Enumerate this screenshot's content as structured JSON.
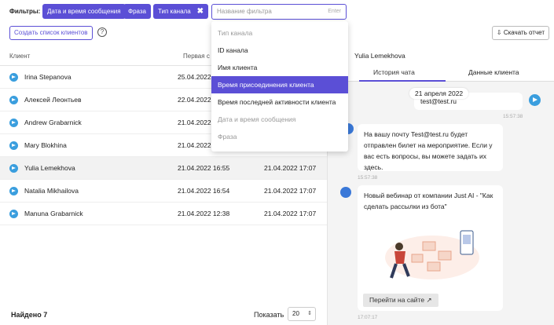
{
  "filters": {
    "label": "Фильтры:",
    "chips": [
      "Дата и время сообщения",
      "Фраза",
      "Тип канала"
    ],
    "chip_close": "✖",
    "input_placeholder": "Название фильтра",
    "input_hint": "Enter"
  },
  "toolbar": {
    "create_list": "Создать список клиентов",
    "help": "?",
    "report": "Скачать отчет"
  },
  "table": {
    "headers": [
      "Клиент",
      "Первая с"
    ],
    "rows": [
      {
        "name": "Irina Stepanova",
        "d1": "25.04.2022",
        "d2": ""
      },
      {
        "name": "Алексей Леонтьев",
        "d1": "22.04.2022",
        "d2": ""
      },
      {
        "name": "Andrew Grabarnick",
        "d1": "21.04.2022",
        "d2": ""
      },
      {
        "name": "Mary Blokhina",
        "d1": "21.04.2022",
        "d2": ""
      },
      {
        "name": "Yulia Lemekhova",
        "d1": "21.04.2022 16:55",
        "d2": "21.04.2022 17:07"
      },
      {
        "name": "Natalia Mikhailova",
        "d1": "21.04.2022 16:54",
        "d2": "21.04.2022 17:07"
      },
      {
        "name": "Manuna Grabarnick",
        "d1": "21.04.2022 12:38",
        "d2": "21.04.2022 17:07"
      }
    ]
  },
  "footer": {
    "found": "Найдено 7",
    "show": "Показать",
    "page_size": "20"
  },
  "panel": {
    "user": "Yulia Lemekhova",
    "tabs": [
      "История чата",
      "Данные клиента"
    ],
    "date": "21 апреля 2022",
    "msg_user": "test@test.ru",
    "time1": "15:57:38",
    "msg_bot1": "На вашу почту Test@test.ru будет отправлен билет на мероприятие. Если у вас есть вопросы, вы можете задать их здесь.",
    "time2": "15:57:38",
    "msg_bot2": "Новый вебинар от компании Just AI - \"Как сделать рассылки из бота\"",
    "site_button": "Перейти на сайте",
    "time3": "17:07:17"
  },
  "dropdown": {
    "items": [
      "Тип канала",
      "ID канала",
      "Имя клиента",
      "Время присоединения клиента",
      "Время последней активности клиента",
      "Дата и время сообщения",
      "Фраза"
    ],
    "highlighted": "Время присоединения клиента"
  },
  "colors": {
    "accent": "#5b4fd6",
    "telegram": "#3a9ede"
  }
}
